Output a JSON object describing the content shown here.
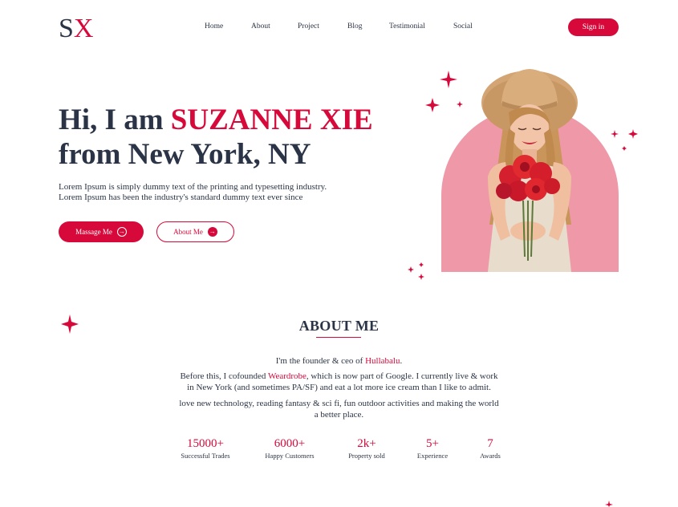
{
  "brand": {
    "logo_s": "S",
    "logo_x": "X",
    "accent_color": "#d6093a",
    "text_color": "#2b3446",
    "arch_color": "#ef98a8"
  },
  "nav": {
    "items": [
      "Home",
      "About",
      "Project",
      "Blog",
      "Testimonial",
      "Social"
    ],
    "signin_label": "Sign in"
  },
  "hero": {
    "title_prefix": "Hi, I am ",
    "title_name": "SUZANNE XIE",
    "title_line2": "from New York, NY",
    "desc_line1": "Lorem Ipsum is simply dummy text of the printing and typesetting industry.",
    "desc_line2": "Lorem Ipsum has been the industry's standard dummy text ever since",
    "btn_primary_label": "Massage Me",
    "btn_primary_icon": "arrow-right-circle-icon",
    "btn_outline_label": "About Me",
    "btn_outline_icon": "arrow-right-circle-filled-icon"
  },
  "about": {
    "title": "ABOUT ME",
    "p1_pre": "I'm the founder & ceo of ",
    "p1_link": "Hullabalu",
    "p1_post": ".",
    "p2_pre": "Before this, I cofounded ",
    "p2_link": "Weardrobe",
    "p2_line1_post": ", which is now part of Google. I currently live & work",
    "p2_line2": "in New York (and sometimes PA/SF) and eat a lot more ice cream than I like to admit.",
    "p3_line1": "love new technology, reading fantasy & sci fi, fun outdoor activities and making the world",
    "p3_line2": "a better place."
  },
  "stats": [
    {
      "value": "15000+",
      "label": "Successful Trades"
    },
    {
      "value": "6000+",
      "label": "Happy Customers"
    },
    {
      "value": "2k+",
      "label": "Property sold"
    },
    {
      "value": "5+",
      "label": "Experience"
    },
    {
      "value": "7",
      "label": "Awards"
    }
  ]
}
